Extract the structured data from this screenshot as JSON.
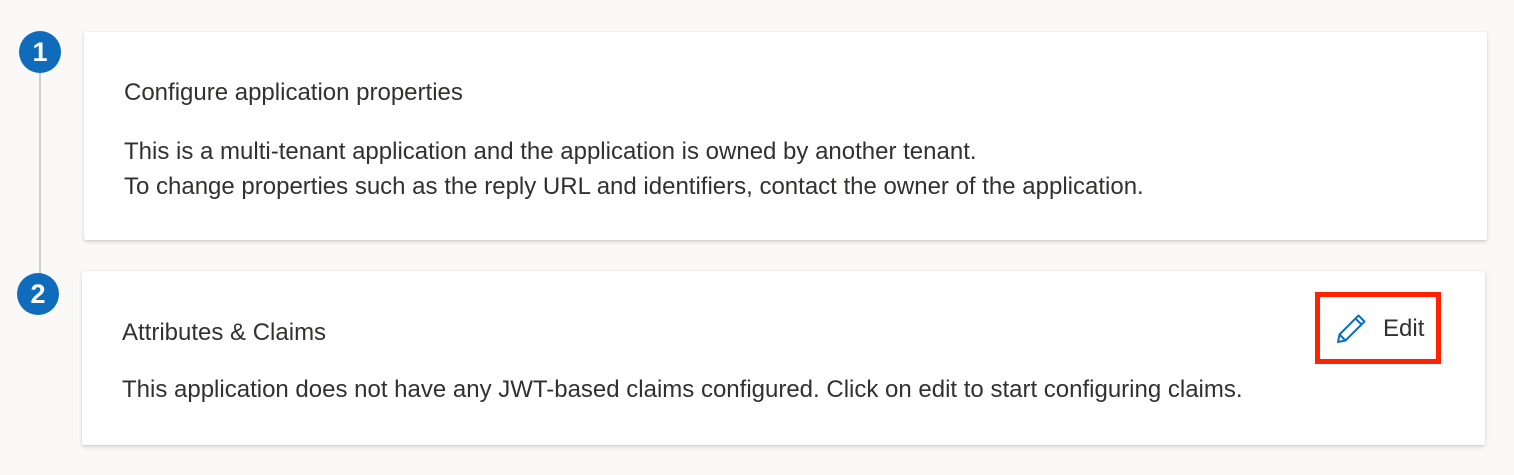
{
  "steps": [
    {
      "number": "1",
      "title": "Configure application properties",
      "body_lines": [
        "This is a multi-tenant application and the application is owned by another tenant.",
        "To change properties such as the reply URL and identifiers, contact the owner of the application."
      ]
    },
    {
      "number": "2",
      "title": "Attributes & Claims",
      "body_lines": [
        "This application does not have any JWT-based claims configured. Click on edit to start configuring claims."
      ],
      "action": {
        "label": "Edit",
        "icon": "pencil-icon",
        "highlighted": true
      }
    }
  ],
  "colors": {
    "step_badge": "#0f6cbd",
    "edit_icon": "#0f6cbd",
    "highlight": "#ff2200",
    "text": "#323130"
  }
}
